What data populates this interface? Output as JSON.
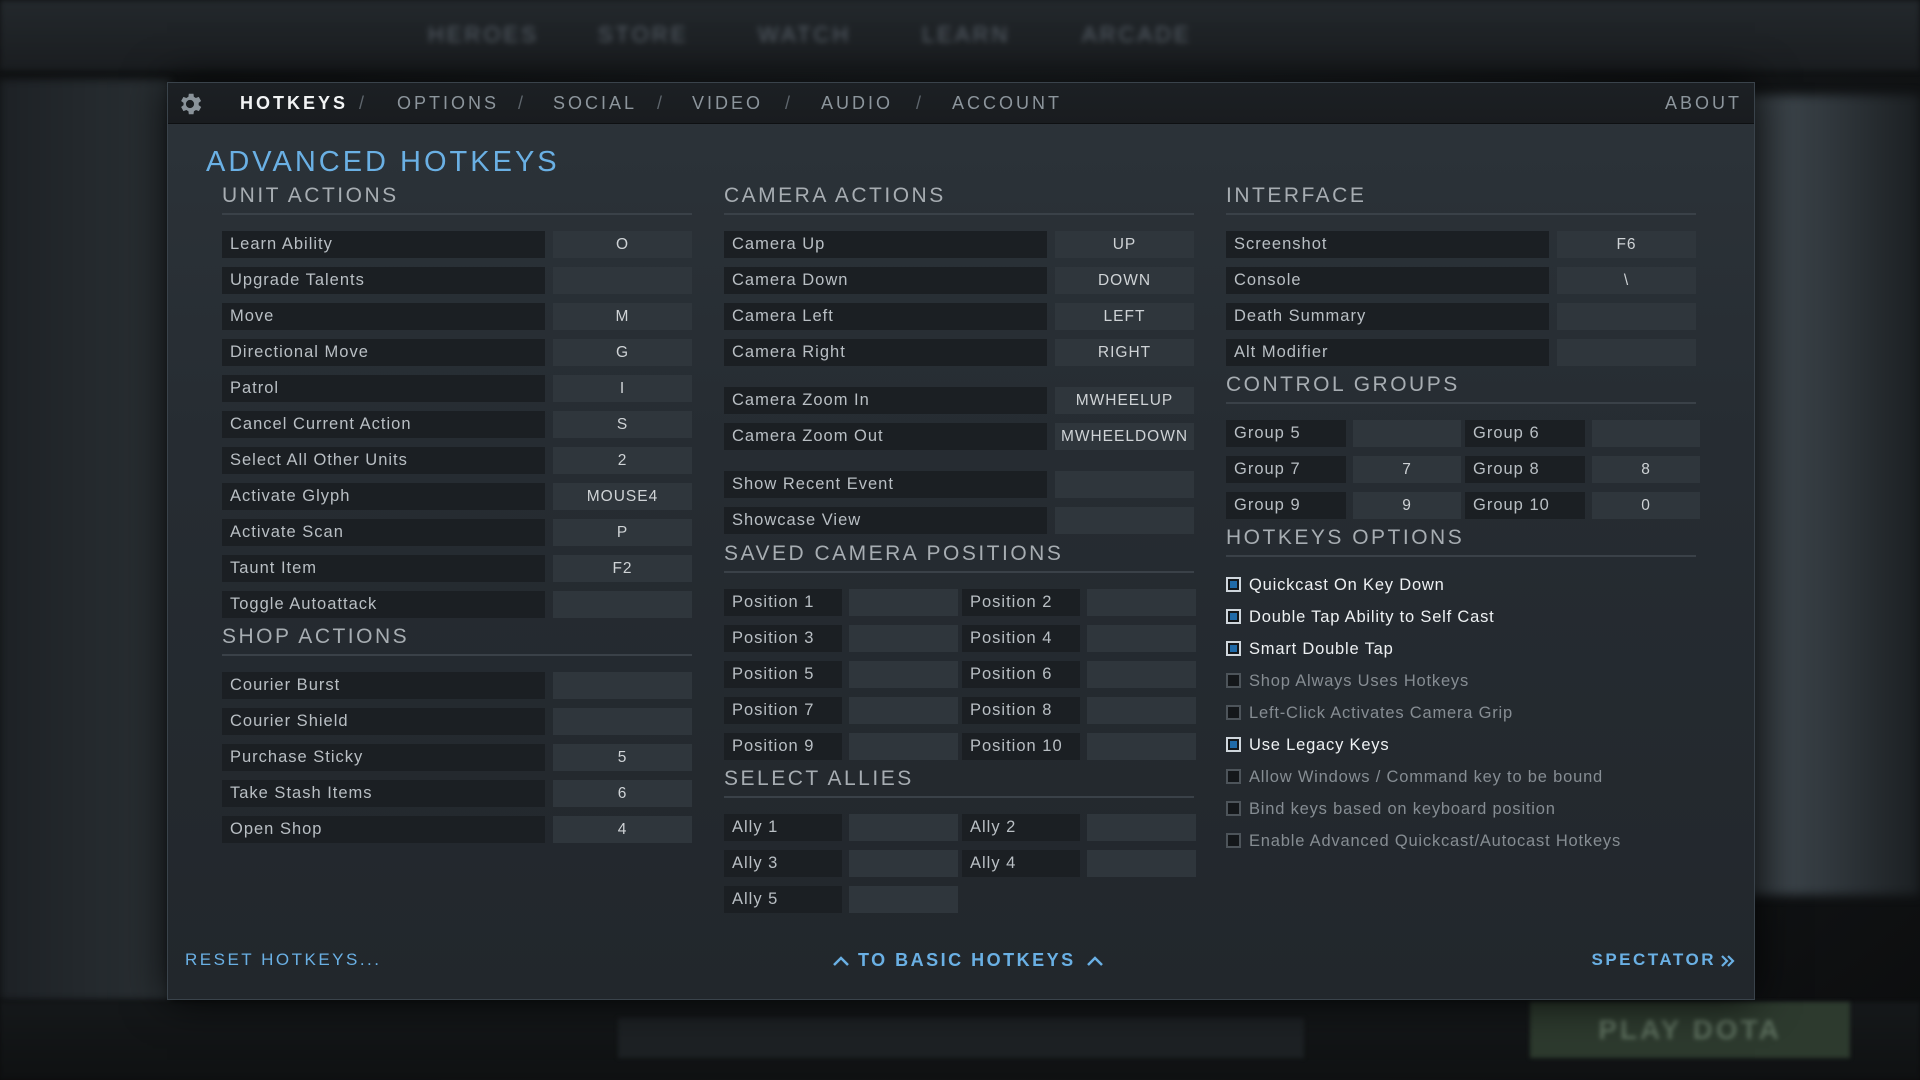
{
  "background": {
    "nav_items": [
      "HEROES",
      "STORE",
      "WATCH",
      "LEARN",
      "ARCADE"
    ],
    "play_button": "PLAY DOTA"
  },
  "tabs": {
    "items": [
      {
        "label": "HOTKEYS",
        "active": true
      },
      {
        "label": "OPTIONS",
        "active": false
      },
      {
        "label": "SOCIAL",
        "active": false
      },
      {
        "label": "VIDEO",
        "active": false
      },
      {
        "label": "AUDIO",
        "active": false
      },
      {
        "label": "ACCOUNT",
        "active": false
      }
    ],
    "separator": "/",
    "about": "ABOUT"
  },
  "title": "ADVANCED HOTKEYS",
  "unit_actions": {
    "title": "UNIT ACTIONS",
    "rows": [
      {
        "label": "Learn Ability",
        "key": "O"
      },
      {
        "label": "Upgrade Talents",
        "key": ""
      },
      {
        "label": "Move",
        "key": "M"
      },
      {
        "label": "Directional Move",
        "key": "G"
      },
      {
        "label": "Patrol",
        "key": "I"
      },
      {
        "label": "Cancel Current Action",
        "key": "S"
      },
      {
        "label": "Select All Other Units",
        "key": "2"
      },
      {
        "label": "Activate Glyph",
        "key": "MOUSE4"
      },
      {
        "label": "Activate Scan",
        "key": "P"
      },
      {
        "label": "Taunt Item",
        "key": "F2"
      },
      {
        "label": "Toggle Autoattack",
        "key": ""
      }
    ]
  },
  "shop_actions": {
    "title": "SHOP ACTIONS",
    "rows": [
      {
        "label": "Courier Burst",
        "key": ""
      },
      {
        "label": "Courier Shield",
        "key": ""
      },
      {
        "label": "Purchase Sticky",
        "key": "5"
      },
      {
        "label": "Take Stash Items",
        "key": "6"
      },
      {
        "label": "Open Shop",
        "key": "4"
      }
    ]
  },
  "camera_actions": {
    "title": "CAMERA ACTIONS",
    "rows": [
      {
        "label": "Camera Up",
        "key": "UP"
      },
      {
        "label": "Camera Down",
        "key": "DOWN"
      },
      {
        "label": "Camera Left",
        "key": "LEFT"
      },
      {
        "label": "Camera Right",
        "key": "RIGHT"
      },
      {
        "label": "Camera Zoom In",
        "key": "MWHEELUP"
      },
      {
        "label": "Camera Zoom Out",
        "key": "MWHEELDOWN"
      },
      {
        "label": "Show Recent Event",
        "key": ""
      },
      {
        "label": "Showcase View",
        "key": ""
      }
    ]
  },
  "saved_camera": {
    "title": "SAVED CAMERA POSITIONS",
    "rows": [
      {
        "label": "Position 1",
        "key": ""
      },
      {
        "label": "Position 2",
        "key": ""
      },
      {
        "label": "Position 3",
        "key": ""
      },
      {
        "label": "Position 4",
        "key": ""
      },
      {
        "label": "Position 5",
        "key": ""
      },
      {
        "label": "Position 6",
        "key": ""
      },
      {
        "label": "Position 7",
        "key": ""
      },
      {
        "label": "Position 8",
        "key": ""
      },
      {
        "label": "Position 9",
        "key": ""
      },
      {
        "label": "Position 10",
        "key": ""
      }
    ]
  },
  "select_allies": {
    "title": "SELECT ALLIES",
    "rows": [
      {
        "label": "Ally 1",
        "key": ""
      },
      {
        "label": "Ally 2",
        "key": ""
      },
      {
        "label": "Ally 3",
        "key": ""
      },
      {
        "label": "Ally 4",
        "key": ""
      },
      {
        "label": "Ally 5",
        "key": ""
      }
    ]
  },
  "interface": {
    "title": "INTERFACE",
    "rows": [
      {
        "label": "Screenshot",
        "key": "F6"
      },
      {
        "label": "Console",
        "key": "\\"
      },
      {
        "label": "Death Summary",
        "key": ""
      },
      {
        "label": "Alt Modifier",
        "key": ""
      }
    ]
  },
  "control_groups": {
    "title": "CONTROL GROUPS",
    "rows": [
      {
        "label": "Group 5",
        "key": ""
      },
      {
        "label": "Group 6",
        "key": ""
      },
      {
        "label": "Group 7",
        "key": "7"
      },
      {
        "label": "Group 8",
        "key": "8"
      },
      {
        "label": "Group 9",
        "key": "9"
      },
      {
        "label": "Group 10",
        "key": "0"
      }
    ]
  },
  "hotkeys_options": {
    "title": "HOTKEYS OPTIONS",
    "items": [
      {
        "label": "Quickcast On Key Down",
        "checked": true
      },
      {
        "label": "Double Tap Ability to Self Cast",
        "checked": true
      },
      {
        "label": "Smart Double Tap",
        "checked": true
      },
      {
        "label": "Shop Always Uses Hotkeys",
        "checked": false
      },
      {
        "label": "Left-Click Activates Camera Grip",
        "checked": false
      },
      {
        "label": "Use Legacy Keys",
        "checked": true
      },
      {
        "label": "Allow Windows / Command key to be bound",
        "checked": false
      },
      {
        "label": "Bind keys based on keyboard position",
        "checked": false
      },
      {
        "label": "Enable Advanced Quickcast/Autocast Hotkeys",
        "checked": false
      }
    ]
  },
  "footer": {
    "reset": "RESET HOTKEYS...",
    "basic": "TO BASIC HOTKEYS",
    "spectator": "SPECTATOR"
  },
  "colors": {
    "accent": "#6ab0e4",
    "checkbox_on": "#1f6aa8"
  }
}
